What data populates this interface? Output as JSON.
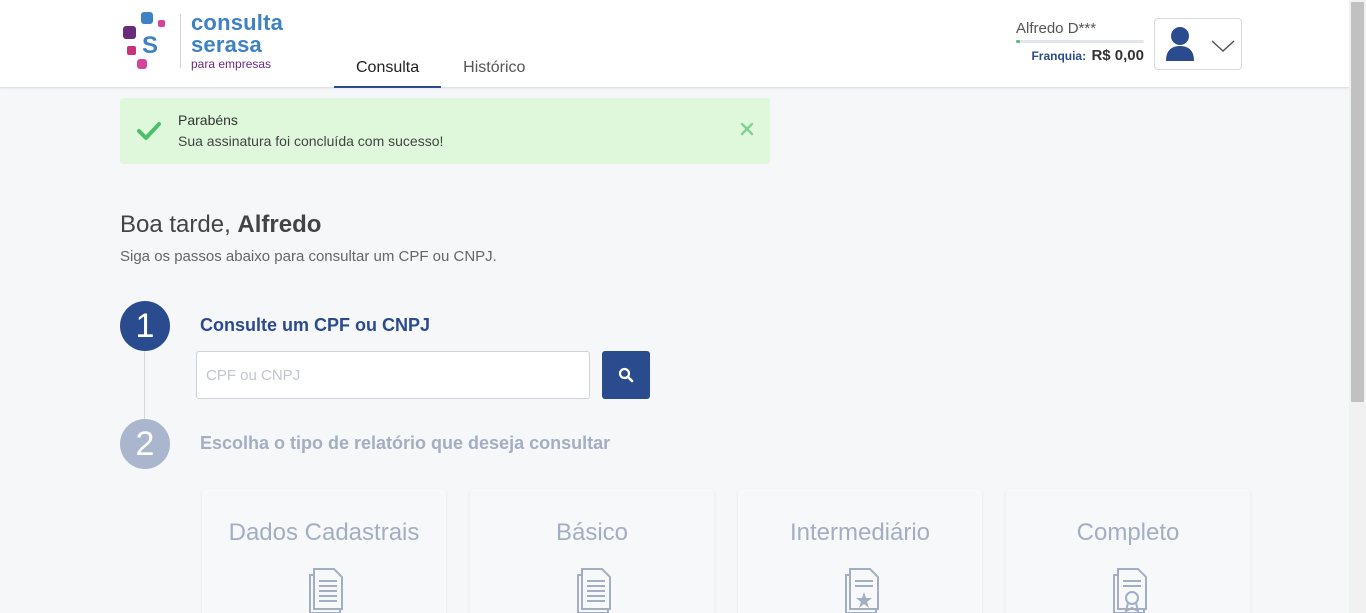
{
  "brand": {
    "line1": "consulta",
    "line2": "serasa",
    "line3": "para empresas",
    "dot_colors": [
      "#3f82c4",
      "#d6449a",
      "#6b2b7d",
      "#c7327a",
      "#3f82c4"
    ]
  },
  "nav": {
    "tabs": [
      {
        "label": "Consulta",
        "active": true
      },
      {
        "label": "Histórico",
        "active": false
      }
    ]
  },
  "user": {
    "name": "Alfredo D***",
    "franquia_label": "Franquia:",
    "franquia_value": "R$ 0,00"
  },
  "alert": {
    "title": "Parabéns",
    "message": "Sua assinatura foi concluída com sucesso!"
  },
  "greeting": {
    "prefix": "Boa tarde, ",
    "name": "Alfredo",
    "subtitle": "Siga os passos abaixo para consultar um CPF ou CNPJ."
  },
  "steps": [
    {
      "number": "1",
      "title": "Consulte um CPF ou CNPJ"
    },
    {
      "number": "2",
      "title": "Escolha o tipo de relatório que deseja consultar"
    }
  ],
  "search": {
    "placeholder": "CPF ou CNPJ",
    "value": ""
  },
  "report_types": [
    {
      "title": "Dados Cadastrais",
      "icon": "document-lines-icon"
    },
    {
      "title": "Básico",
      "icon": "document-lines-icon"
    },
    {
      "title": "Intermediário",
      "icon": "document-star-icon"
    },
    {
      "title": "Completo",
      "icon": "document-badge-icon"
    }
  ],
  "colors": {
    "primary": "#2a4b8d",
    "success_bg": "#dff8dc",
    "success": "#4bbf6b",
    "muted": "#a3aec2"
  }
}
